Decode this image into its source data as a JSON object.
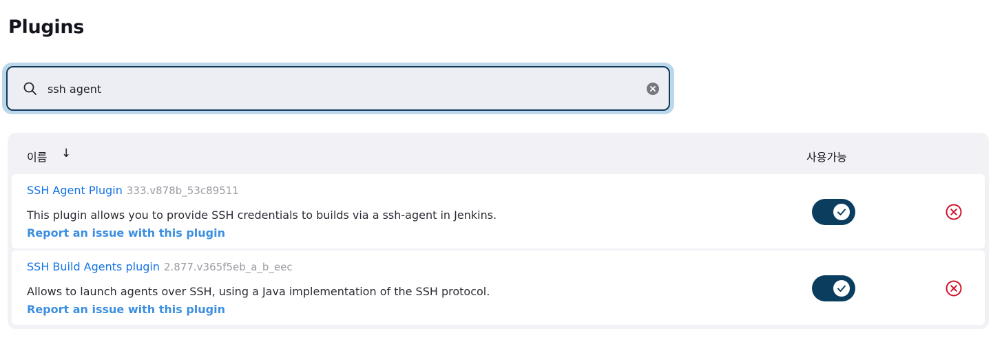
{
  "page": {
    "title": "Plugins"
  },
  "search": {
    "value": "ssh agent",
    "icon": "search-icon",
    "clear_icon": "clear-icon"
  },
  "table": {
    "columns": {
      "name": "이름",
      "sort_indicator": "↓",
      "enabled": "사용가능"
    },
    "rows": [
      {
        "name": "SSH Agent Plugin",
        "version": "333.v878b_53c89511",
        "description": "This plugin allows you to provide SSH credentials to builds via a ssh-agent in Jenkins.",
        "report_link": "Report an issue with this plugin",
        "enabled": true
      },
      {
        "name": "SSH Build Agents plugin",
        "version": "2.877.v365f5eb_a_b_eec",
        "description": "Allows to launch agents over SSH, using a Java implementation of the SSH protocol.",
        "report_link": "Report an issue with this plugin",
        "enabled": true
      }
    ]
  },
  "colors": {
    "accent": "#0b3d5f",
    "link": "#1473e6",
    "danger": "#d0112b"
  }
}
